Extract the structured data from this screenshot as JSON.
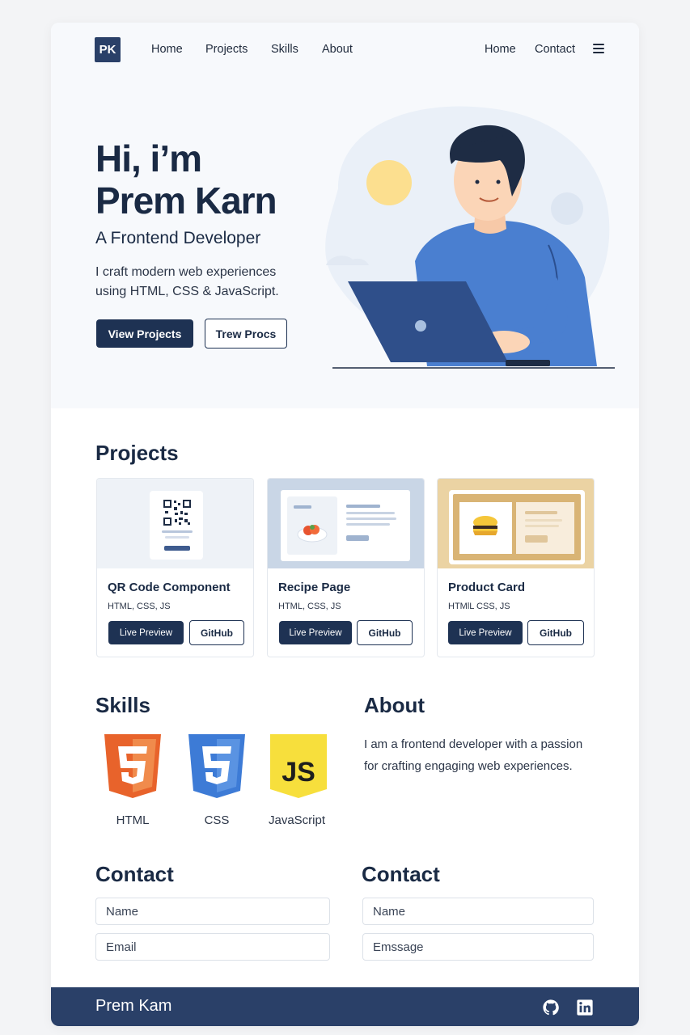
{
  "nav": {
    "logo": "PK",
    "left_links": [
      "Home",
      "Projects",
      "Skills",
      "About"
    ],
    "right_links": [
      "Home",
      "Contact"
    ]
  },
  "hero": {
    "title_line1": "Hi, i’m",
    "title_line2": "Prem Karn",
    "subtitle": "A Frontend Developer",
    "description": "I craft modern web experiences using HTML, CSS & JavaScript.",
    "primary_button": "View Projects",
    "secondary_button": "Trew Procs"
  },
  "projects": {
    "title": "Projects",
    "cards": [
      {
        "title": "QR Code Component",
        "tags": "HTML, CSS, JS",
        "preview": "Live Preview",
        "github": "GitHub"
      },
      {
        "title": "Recipe Page",
        "tags": "HTML, CSS, JS",
        "preview": "Live Preview",
        "github": "GitHub"
      },
      {
        "title": "Product Card",
        "tags": "HTMlL CSS, JS",
        "preview": "Live Preview",
        "github": "GitHub"
      }
    ]
  },
  "skills": {
    "title": "Skills",
    "items": [
      {
        "label": "HTML",
        "icon": "html5-icon",
        "color": "#e8632b"
      },
      {
        "label": "CSS",
        "icon": "css3-icon",
        "color": "#3d7bd6"
      },
      {
        "label": "JavaScript",
        "icon": "js-icon",
        "color": "#f7df3c"
      }
    ]
  },
  "about": {
    "title": "About",
    "text": "I am a frontend developer with a passion for crafting engaging web experiences."
  },
  "contact_left": {
    "title": "Contact",
    "name_placeholder": "Name",
    "email_placeholder": "Email"
  },
  "contact_right": {
    "title": "Contact",
    "name_placeholder": "Name",
    "message_placeholder": "Emssage"
  },
  "footer": {
    "name": "Prem Kam",
    "icons": [
      "github-icon",
      "linkedin-icon"
    ]
  },
  "colors": {
    "primary": "#1e3253",
    "footer": "#2a4068",
    "shirt": "#4a7fd0"
  }
}
